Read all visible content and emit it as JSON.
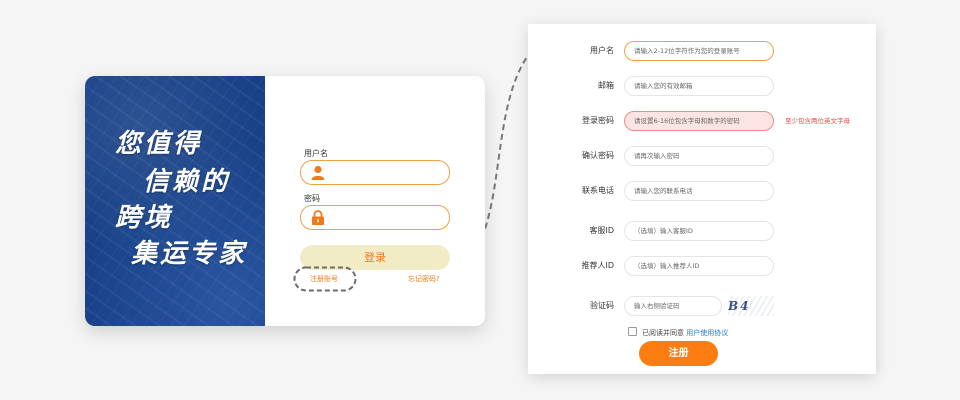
{
  "login": {
    "slogan": [
      "您值得",
      "信赖的",
      "跨境",
      "集运专家"
    ],
    "username_label": "用户名",
    "password_label": "密码",
    "login_button": "登录",
    "register_link": "注册账号",
    "forgot_link": "忘记密码?"
  },
  "register": {
    "fields": [
      {
        "label": "用户名",
        "placeholder": "请输入2-12位字符作为您的登录账号"
      },
      {
        "label": "邮箱",
        "placeholder": "请输入您的有效邮箱"
      },
      {
        "label": "登录密码",
        "placeholder": "请设置6-16位包含字母和数字的密码",
        "error": "至少包含两位英文字母"
      },
      {
        "label": "确认密码",
        "placeholder": "请再次输入密码"
      },
      {
        "label": "联系电话",
        "placeholder": "请输入您的联系电话"
      },
      {
        "label": "客服ID",
        "placeholder": "（选填）输入客服ID"
      },
      {
        "label": "推荐人ID",
        "placeholder": "（选填）输入推荐人ID"
      },
      {
        "label": "验证码",
        "placeholder": "输入右侧验证码"
      }
    ],
    "captcha_text": "B4",
    "agree_text": "已阅读并同意",
    "agree_link": "用户使用协议",
    "submit_button": "注册"
  },
  "colors": {
    "accent": "#fb7c10",
    "banner": "#163f86",
    "error": "#ee4545",
    "link": "#1e7ad6"
  }
}
